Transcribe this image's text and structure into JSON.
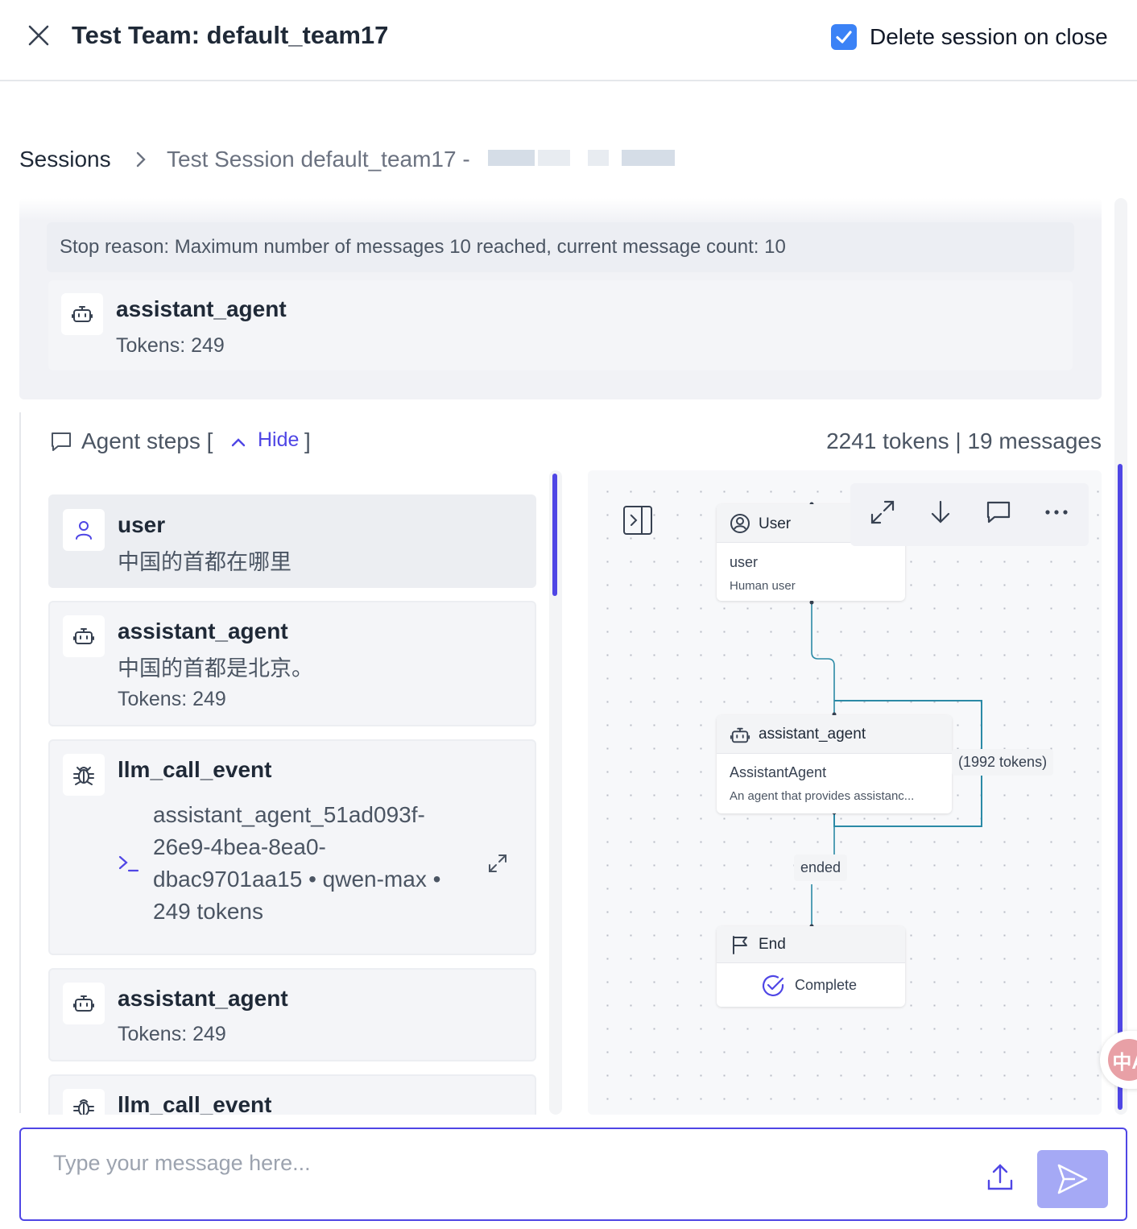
{
  "header": {
    "title": "Test Team: default_team17",
    "delete_session_label": "Delete session on close",
    "delete_session_checked": true
  },
  "breadcrumb": {
    "root": "Sessions",
    "current": "Test Session default_team17 -"
  },
  "summary": {
    "stop_reason": "Stop reason: Maximum number of messages 10 reached, current message count: 10",
    "agent_name": "assistant_agent",
    "agent_tokens": "Tokens: 249"
  },
  "steps": {
    "title": "Agent steps [",
    "hide_label": "Hide",
    "bracket_close": "]",
    "stats": "2241 tokens | 19 messages",
    "items": [
      {
        "name": "user",
        "text": "中国的首都在哪里",
        "icon": "user-icon"
      },
      {
        "name": "assistant_agent",
        "text": "中国的首都是北京。",
        "tokens": "Tokens: 249",
        "icon": "robot-icon"
      },
      {
        "name": "llm_call_event",
        "lines": [
          "assistant_agent_51ad093f-",
          "26e9-4bea-8ea0-",
          "dbac9701aa15 • qwen-max •",
          "249 tokens"
        ],
        "icon": "bug-icon"
      },
      {
        "name": "assistant_agent",
        "tokens": "Tokens: 249",
        "icon": "robot-icon"
      },
      {
        "name": "llm_call_event",
        "icon": "bug-icon"
      }
    ]
  },
  "graph": {
    "nodes": {
      "user": {
        "title": "User",
        "line1": "user",
        "line2": "Human user"
      },
      "agent": {
        "title": "assistant_agent",
        "line1": "AssistantAgent",
        "line2": "An agent that provides assistanc..."
      },
      "end": {
        "title": "End",
        "status": "Complete"
      }
    },
    "edge_labels": {
      "loop": "(1992 tokens)",
      "ended": "ended"
    },
    "edge_color": "#2b8aa6"
  },
  "badge_text": "中A",
  "input": {
    "placeholder": "Type your message here..."
  },
  "colors": {
    "accent": "#4f46e5",
    "checkbox": "#3b82f6",
    "send_button": "#a5a9f5"
  }
}
